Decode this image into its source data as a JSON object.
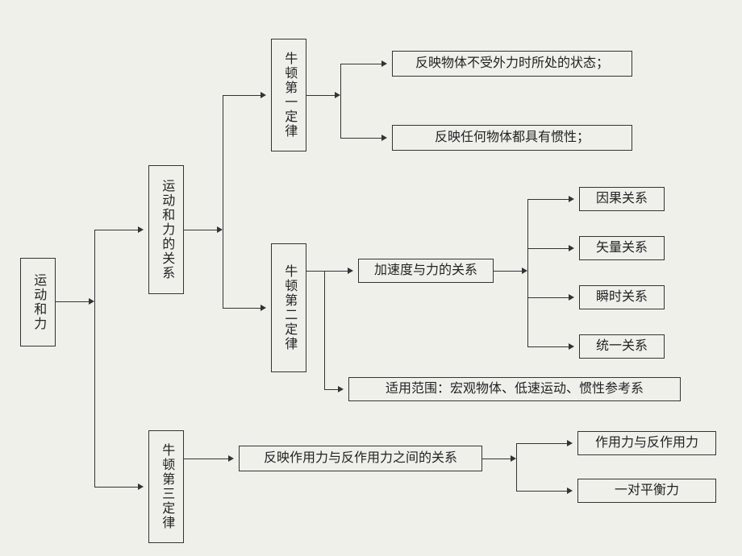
{
  "root": "运动和力",
  "branch1": "运动和力的关系",
  "law1": "牛顿第一定律",
  "law1_desc1": "反映物体不受外力时所处的状态；",
  "law1_desc2": "反映任何物体都具有惯性；",
  "law2": "牛顿第二定律",
  "law2_main": "加速度与力的关系",
  "law2_r1": "因果关系",
  "law2_r2": "矢量关系",
  "law2_r3": "瞬时关系",
  "law2_r4": "统一关系",
  "law2_scope": "适用范围：宏观物体、低速运动、惯性参考系",
  "law3": "牛顿第三定律",
  "law3_main": "反映作用力与反作用力之间的关系",
  "law3_r1": "作用力与反作用力",
  "law3_r2": "一对平衡力"
}
